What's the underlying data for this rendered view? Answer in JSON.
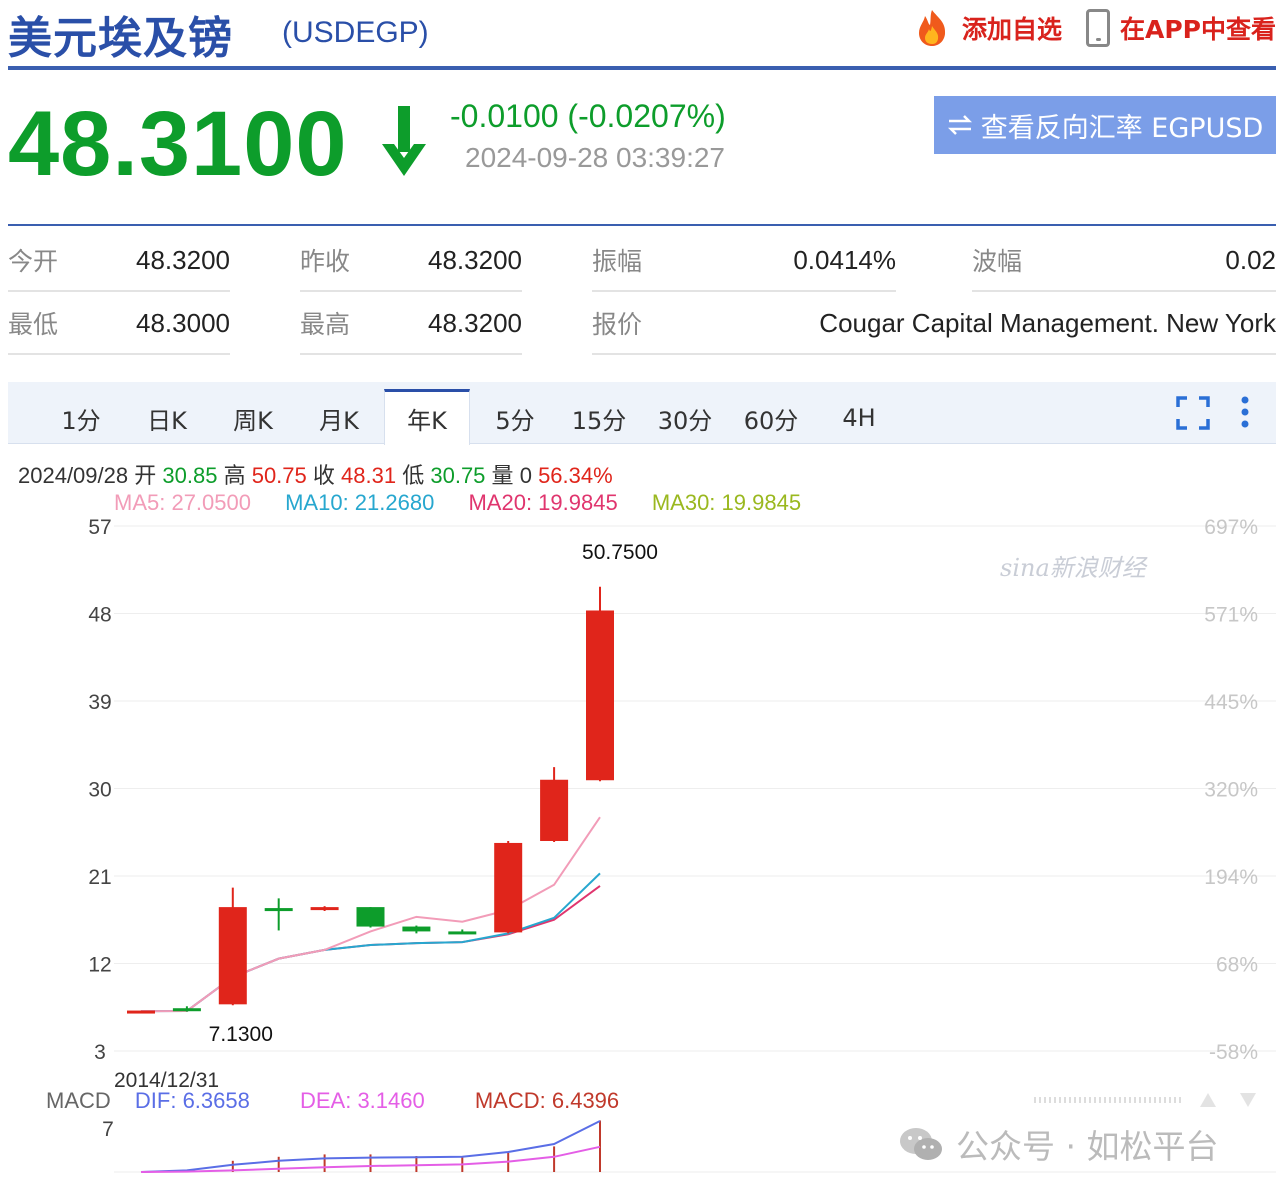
{
  "header": {
    "title": "美元埃及镑",
    "code": "(USDEGP)",
    "add_watch": "添加自选",
    "app_view": "在APP中查看"
  },
  "quote": {
    "price": "48.3100",
    "change": "-0.0100 (-0.0207%)",
    "timestamp": "2024-09-28 03:39:27",
    "reverse_button": "查看反向汇率 EGPUSD",
    "down_color": "#0d9d2b",
    "up_color": "#e0251b"
  },
  "stats": [
    {
      "label": "今开",
      "value": "48.3200"
    },
    {
      "label": "昨收",
      "value": "48.3200"
    },
    {
      "label": "振幅",
      "value": "0.0414%"
    },
    {
      "label": "波幅",
      "value": "0.02"
    },
    {
      "label": "最低",
      "value": "48.3000"
    },
    {
      "label": "最高",
      "value": "48.3200"
    },
    {
      "label": "报价",
      "value": "Cougar Capital Management. New York"
    }
  ],
  "tabs": [
    "1分",
    "日K",
    "周K",
    "月K",
    "年K",
    "5分",
    "15分",
    "30分",
    "60分",
    "4H"
  ],
  "active_tab": "年K",
  "ohlc": {
    "date": "2024/09/28",
    "open_label": "开",
    "open": "30.85",
    "high_label": "高",
    "high": "50.75",
    "close_label": "收",
    "close": "48.31",
    "low_label": "低",
    "low": "30.75",
    "vol_label": "量",
    "vol": "0",
    "pct": "56.34%"
  },
  "ma": {
    "ma5": "MA5: 27.0500",
    "ma10": "MA10: 21.2680",
    "ma20": "MA20: 19.9845",
    "ma30": "MA30: 19.9845",
    "colors": {
      "ma5": "#f29cb8",
      "ma10": "#27a7cf",
      "ma20": "#e0356e",
      "ma30": "#9ab81f"
    }
  },
  "macd": {
    "label": "MACD",
    "dif": "DIF: 6.3658",
    "dea": "DEA: 3.1460",
    "macd": "MACD: 6.4396"
  },
  "watermark": {
    "sina": "sina新浪财经",
    "wechat": "公众号 · 如松平台"
  },
  "chart_data": {
    "type": "candlestick",
    "y_ticks": [
      3,
      12,
      21,
      30,
      39,
      48,
      57
    ],
    "pct_ticks": [
      "697%",
      "571%",
      "445%",
      "320%",
      "194%",
      "68%",
      "-58%"
    ],
    "ylim": [
      3,
      57
    ],
    "x_label": "2014/12/31",
    "max_label": "50.7500",
    "min_label": "7.1300",
    "candles": [
      {
        "o": 7.13,
        "h": 7.15,
        "c": 7.16,
        "l": 7.12
      },
      {
        "o": 7.4,
        "h": 7.6,
        "c": 7.1,
        "l": 7.05
      },
      {
        "o": 7.8,
        "h": 19.8,
        "c": 17.8,
        "l": 7.7
      },
      {
        "o": 17.7,
        "h": 18.7,
        "c": 17.5,
        "l": 15.4
      },
      {
        "o": 17.6,
        "h": 17.9,
        "c": 17.8,
        "l": 17.4
      },
      {
        "o": 17.8,
        "h": 17.8,
        "c": 15.8,
        "l": 15.7
      },
      {
        "o": 15.8,
        "h": 15.9,
        "c": 15.3,
        "l": 15.1
      },
      {
        "o": 15.3,
        "h": 15.5,
        "c": 15.2,
        "l": 15.1
      },
      {
        "o": 15.2,
        "h": 24.6,
        "c": 24.4,
        "l": 15.1
      },
      {
        "o": 24.6,
        "h": 32.2,
        "c": 30.9,
        "l": 24.5
      },
      {
        "o": 30.85,
        "h": 50.75,
        "c": 48.31,
        "l": 30.75
      }
    ],
    "ma5": [
      7.1,
      7.12,
      10.6,
      12.5,
      13.4,
      15.3,
      16.8,
      16.3,
      17.5,
      20.1,
      27.05
    ],
    "ma10": [
      7.1,
      7.12,
      10.6,
      12.5,
      13.4,
      13.9,
      14.1,
      14.2,
      15.1,
      16.7,
      21.27
    ],
    "ma20": [
      7.1,
      7.12,
      10.6,
      12.5,
      13.4,
      13.9,
      14.1,
      14.2,
      15.0,
      16.5,
      19.98
    ],
    "macd_dif": [
      0,
      0.2,
      0.9,
      1.4,
      1.7,
      1.8,
      1.85,
      1.9,
      2.5,
      3.5,
      6.37
    ],
    "macd_dea": [
      0,
      0.05,
      0.2,
      0.4,
      0.6,
      0.75,
      0.85,
      0.95,
      1.3,
      1.9,
      3.15
    ],
    "macd_bar": [
      0,
      0.3,
      1.4,
      1.9,
      2.2,
      2.2,
      2.0,
      1.9,
      2.4,
      3.2,
      6.44
    ],
    "macd_tick": 7
  }
}
